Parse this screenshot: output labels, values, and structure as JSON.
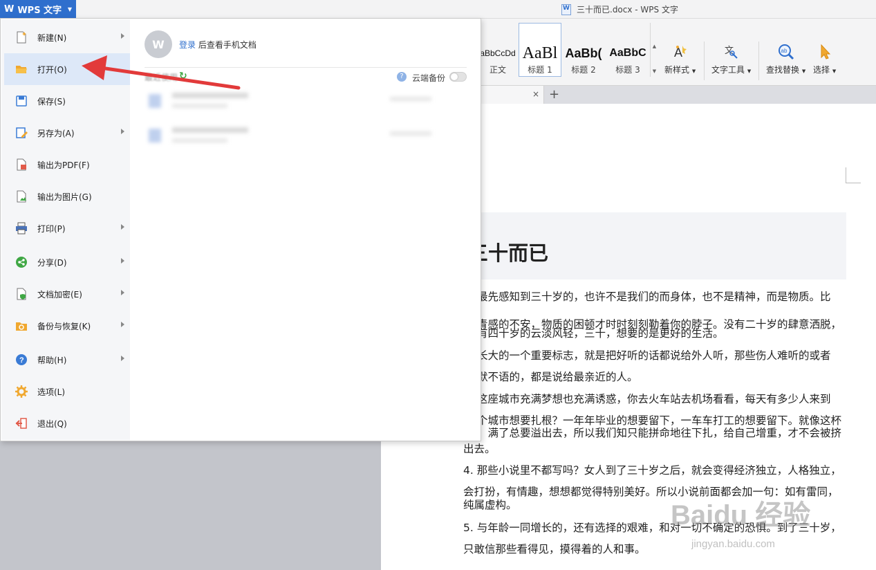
{
  "titlebar": {
    "app_button_label": "WPS 文字",
    "app_logo": "W",
    "document_title": "三十而已.docx - WPS 文字"
  },
  "ribbon": {
    "styles": [
      {
        "sample": "aBbCcDd",
        "label": "正文"
      },
      {
        "sample": "AaBl",
        "label": "标题 1"
      },
      {
        "sample": "AaBb(",
        "label": "标题 2"
      },
      {
        "sample": "AaBbC",
        "label": "标题 3"
      }
    ],
    "tools": [
      {
        "label": "新样式",
        "icon": "new-style-icon"
      },
      {
        "label": "文字工具",
        "icon": "text-tools-icon"
      },
      {
        "label": "查找替换",
        "icon": "find-replace-icon"
      },
      {
        "label": "选择",
        "icon": "select-cursor-icon"
      }
    ]
  },
  "tabs": {
    "close": "×",
    "add": "+"
  },
  "menu": {
    "items": [
      {
        "label": "新建(N)",
        "icon": "new-document-icon",
        "has_submenu": true
      },
      {
        "label": "打开(O)",
        "icon": "open-folder-icon",
        "has_submenu": false,
        "active": true
      },
      {
        "label": "保存(S)",
        "icon": "save-icon",
        "has_submenu": false
      },
      {
        "label": "另存为(A)",
        "icon": "save-as-icon",
        "has_submenu": true
      },
      {
        "label": "输出为PDF(F)",
        "icon": "export-pdf-icon",
        "has_submenu": false
      },
      {
        "label": "输出为图片(G)",
        "icon": "export-image-icon",
        "has_submenu": false
      },
      {
        "label": "打印(P)",
        "icon": "print-icon",
        "has_submenu": true
      },
      {
        "label": "分享(D)",
        "icon": "share-icon",
        "has_submenu": true
      },
      {
        "label": "文档加密(E)",
        "icon": "encrypt-document-icon",
        "has_submenu": true
      },
      {
        "label": "备份与恢复(K)",
        "icon": "backup-restore-icon",
        "has_submenu": true
      },
      {
        "label": "帮助(H)",
        "icon": "help-icon",
        "has_submenu": true
      },
      {
        "label": "选项(L)",
        "icon": "options-gear-icon",
        "has_submenu": false
      },
      {
        "label": "退出(Q)",
        "icon": "exit-icon",
        "has_submenu": false
      }
    ],
    "account": {
      "avatar_letter": "W",
      "login_link": "登录",
      "login_suffix": "后查看手机文档"
    },
    "recent_label": "最近使用",
    "cloud_backup_label": "云端备份",
    "cloud_backup_enabled": false
  },
  "document": {
    "heading": "三十而已",
    "lines": [
      "最先感知到三十岁的，也许不是我们的而身体，也不是精神，而是物质。比",
      "青感的不安，物质的困顿才时时刻刻勒着你的脖子。没有二十岁的肆意洒脱，",
      "有四十岁的云淡风轻，三十，想要的是更好的生活。",
      "长大的一个重要标志，就是把好听的话都说给外人听，那些伤人难听的或者",
      "默不语的，都是说给最亲近的人。",
      "这座城市充满梦想也充满诱惑，你去火车站去机场看看，每天有多少人来到",
      "个城市想要扎根？一年年毕业的想要留下，一车车打工的想要留下。就像这杯",
      "，满了总要溢出去，所以我们知只能拼命地往下扎，给自己增重，才不会被挤",
      "出去。",
      "4. 那些小说里不都写吗？女人到了三十岁之后，就会变得经济独立，人格独立，",
      "会打扮，有情趣，想想都觉得特别美好。所以小说前面都会加一句：如有雷同，",
      "纯属虚构。",
      "5. 与年龄一同增长的，还有选择的艰难，和对一切不确定的恐惧。到了三十岁，",
      "只敢信那些看得见，摸得着的人和事。"
    ]
  },
  "watermark": {
    "main": "Baidu 经验",
    "sub": "jingyan.baidu.com"
  },
  "colors": {
    "accent": "#2f6fcd",
    "annotation": "#e23a3a",
    "active_item": "#dde8f8"
  }
}
